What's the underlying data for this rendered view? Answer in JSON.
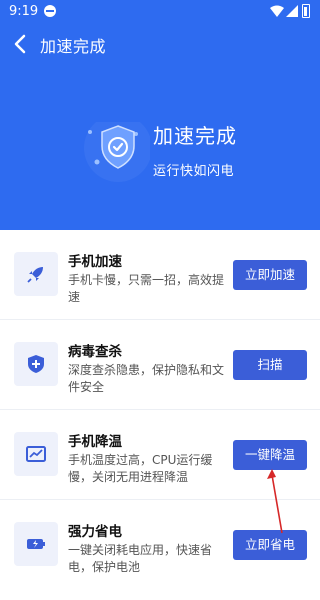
{
  "status_bar": {
    "time": "9:19"
  },
  "header": {
    "title": "加速完成",
    "hero_title": "加速完成",
    "hero_subtitle": "运行快如闪电"
  },
  "cards": [
    {
      "title": "手机加速",
      "desc": "手机卡慢，只需一招，高效提速",
      "button": "立即加速",
      "icon": "rocket-icon"
    },
    {
      "title": "病毒查杀",
      "desc": "深度查杀隐患，保护隐私和文件安全",
      "button": "扫描",
      "icon": "shield-plus-icon"
    },
    {
      "title": "手机降温",
      "desc": "手机温度过高，CPU运行缓慢，关闭无用进程降温",
      "button": "一键降温",
      "icon": "chart-icon"
    },
    {
      "title": "强力省电",
      "desc": "一键关闭耗电应用，快速省电，保护电池",
      "button": "立即省电",
      "icon": "battery-icon"
    }
  ],
  "colors": {
    "header_bg": "#2e6bf0",
    "button_bg": "#3b5ed8",
    "annotation_arrow": "#d62828"
  }
}
